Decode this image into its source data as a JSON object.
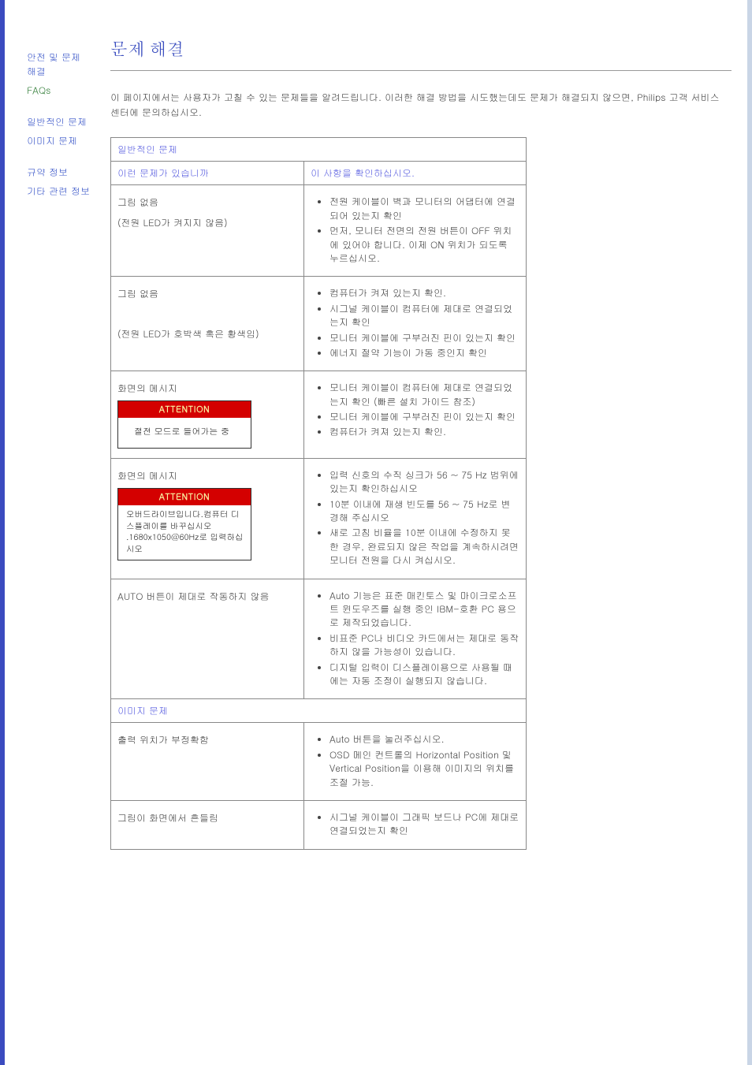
{
  "sidebar": {
    "links": [
      {
        "label": "안전 및 문제 해결",
        "class": ""
      },
      {
        "label": "FAQs",
        "class": "faqs"
      }
    ],
    "links2": [
      {
        "label": "일반적인 문제"
      },
      {
        "label": "이미지 문제"
      }
    ],
    "links3": [
      {
        "label": "규약 정보"
      },
      {
        "label": "기타 관련 정보"
      }
    ]
  },
  "page": {
    "title": "문제 해결",
    "intro": "이 페이지에서는 사용자가 고칠 수 있는 문제들을 알려드립니다. 이러한 해결 방법을 시도했는데도 문제가 해결되지 않으면, Philips 고객 서비스 센터에 문의하십시오."
  },
  "sections": {
    "general": "일반적인 문제",
    "image": "이미지 문제"
  },
  "headers": {
    "problem": "이런 문제가 있습니까",
    "solution": "이 사항을 확인하십시오."
  },
  "rows": [
    {
      "problem_lines": [
        "그림 없음",
        "(전원 LED가 켜지지 않음)"
      ],
      "solutions": [
        "전원 케이블이 벽과 모니터의 어댑터에 연결되어 있는지 확인",
        "먼저, 모니터 전면의 전원 버튼이 OFF 위치에 있어야 합니다. 이제 ON 위치가 되도록 누르십시오."
      ],
      "attention": null
    },
    {
      "problem_lines": [
        "그림 없음",
        "",
        "(전원 LED가 호박색 혹은 황색임)"
      ],
      "solutions": [
        "컴퓨터가 켜져 있는지 확인.",
        "시그널 케이블이 컴퓨터에 제대로 연결되었는지 확인",
        "모니터 케이블에 구부러진 핀이 있는지 확인",
        "에너지 절약 기능이 가동 중인지 확인"
      ],
      "attention": null
    },
    {
      "problem_lines": [
        "화면의 메시지"
      ],
      "solutions": [
        "모니터 케이블이 컴퓨터에 제대로 연결되었는지 확인 (빠른 설치 가이드 참조)",
        "모니터 케이블에 구부러진 핀이 있는지 확인",
        "컴퓨터가 켜져 있는지 확인."
      ],
      "attention": {
        "header": "ATTENTION",
        "body": "절전 모드로 들어가는 중",
        "wide": true
      }
    },
    {
      "problem_lines": [
        "화면의 메시지"
      ],
      "solutions": [
        "입력 신호의 수직 싱크가 56 ~ 75 Hz 범위에 있는지 확인하십시오",
        "10분 이내에 재생 빈도를 56 ~ 75 Hz로 변경해 주십시오",
        "새로 고침 비율을 10분 이내에  수정하지 못한 경우, 완료되지 않은 작업을 계속하시려면 모니터 전원을 다시 켜십시오."
      ],
      "attention": {
        "header": "ATTENTION",
        "body": "오버드라이브입니다.컴퓨터 디스플레이를 바꾸십시오 .1680x1050@60Hz로 입력하십시오",
        "wide": false
      }
    },
    {
      "problem_lines": [
        "AUTO 버튼이 제대로 작동하지 않음"
      ],
      "solutions": [
        "Auto 기능은 표준 매킨토스 및 마이크로소프트 윈도우즈를 실행 중인 IBM-호환 PC 용으로 제작되었습니다.",
        "비표준 PC나 비디오 카드에서는 제대로 동작하지 않을 가능성이 있습니다.",
        "디지털 입력이 디스플레이용으로 사용될 때에는 자동 조정이 실행되지 않습니다."
      ],
      "attention": null
    }
  ],
  "image_rows": [
    {
      "problem_lines": [
        "출력 위치가 부정확함"
      ],
      "solutions": [
        "Auto 버튼을 눌러주십시오.",
        "OSD 메인 컨트롤의 Horizontal Position 및 Vertical Position을 이용해 이미지의 위치를 조절 가능."
      ]
    },
    {
      "problem_lines": [
        "그림이 화면에서 흔들림"
      ],
      "solutions": [
        "시그널 케이블이 그래픽 보드나 PC에 제대로 연결되었는지 확인"
      ]
    }
  ]
}
